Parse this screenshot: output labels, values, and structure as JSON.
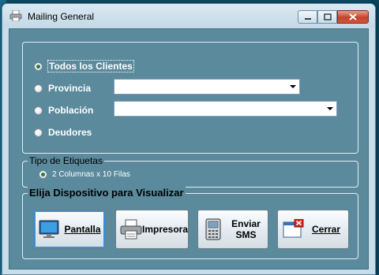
{
  "window": {
    "title": "Mailing General",
    "icon": "printer-icon"
  },
  "titlebar_buttons": [
    {
      "name": "minimize",
      "icon": "minimize-icon"
    },
    {
      "name": "maximize",
      "icon": "maximize-icon"
    },
    {
      "name": "close",
      "icon": "close-icon"
    }
  ],
  "filters": {
    "todos_label": "Todos los Clientes",
    "provincia_label": "Provincia",
    "provincia_value": "",
    "poblacion_label": "Población",
    "poblacion_value": "",
    "deudores_label": "Deudores",
    "selected": "Todos los Clientes"
  },
  "etiquetas": {
    "legend": "Tipo de Etiquetas",
    "option_label": "2 Columnas x 10 Filas"
  },
  "dispositivo": {
    "legend": "Elija Dispositivo para Visualizar",
    "pantalla_label": "Pantalla",
    "impresora_label": "Impresora",
    "enviar_line1": "Enviar",
    "enviar_line2": "SMS",
    "cerrar_label": "Cerrar"
  },
  "colors": {
    "panel": "#5a8a9c",
    "titlebar": "#c9dde8",
    "close_button": "#c4442b"
  }
}
